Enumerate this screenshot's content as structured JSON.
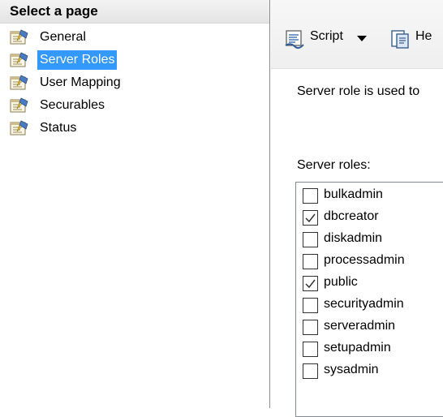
{
  "left_pane": {
    "header": "Select a page",
    "pages": [
      {
        "label": "General",
        "selected": false
      },
      {
        "label": "Server Roles",
        "selected": true
      },
      {
        "label": "User Mapping",
        "selected": false
      },
      {
        "label": "Securables",
        "selected": false
      },
      {
        "label": "Status",
        "selected": false
      }
    ]
  },
  "toolbar": {
    "script_label": "Script",
    "help_label": "He"
  },
  "content": {
    "description": "Server role is used to",
    "roles_label": "Server roles:",
    "roles": [
      {
        "name": "bulkadmin",
        "checked": false
      },
      {
        "name": "dbcreator",
        "checked": true
      },
      {
        "name": "diskadmin",
        "checked": false
      },
      {
        "name": "processadmin",
        "checked": false
      },
      {
        "name": "public",
        "checked": true
      },
      {
        "name": "securityadmin",
        "checked": false
      },
      {
        "name": "serveradmin",
        "checked": false
      },
      {
        "name": "setupadmin",
        "checked": false
      },
      {
        "name": "sysadmin",
        "checked": false
      }
    ]
  },
  "colors": {
    "selection": "#3399ff",
    "border": "#828790"
  }
}
